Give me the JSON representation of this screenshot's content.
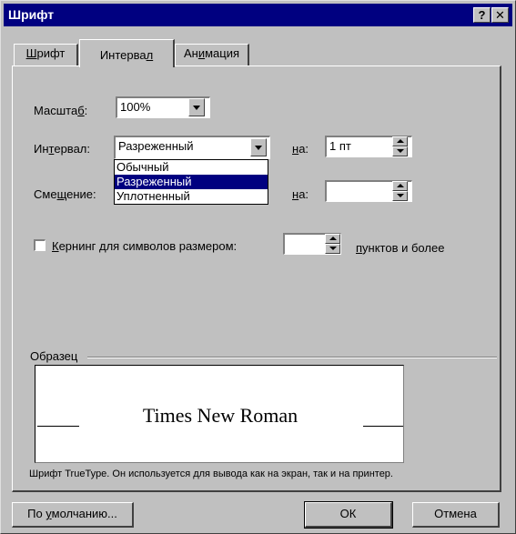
{
  "window": {
    "title": "Шрифт",
    "help_btn": "?",
    "close_btn": "✕"
  },
  "tabs": [
    {
      "label": "Шрифт",
      "underline": "Ш",
      "rest": "рифт"
    },
    {
      "label": "Интервал",
      "before": "Интерва",
      "underline": "л",
      "after": ""
    },
    {
      "label": "Анимация",
      "before": "Ан",
      "underline": "и",
      "after": "мация"
    }
  ],
  "form": {
    "scale_label_before": "Масшта",
    "scale_label_ul": "б",
    "scale_label_after": ":",
    "scale_value": "100%",
    "interval_label_before": "Ин",
    "interval_label_ul": "т",
    "interval_label_after": "ервал:",
    "interval_value": "Разреженный",
    "interval_options": [
      "Обычный",
      "Разреженный",
      "Уплотненный"
    ],
    "interval_selected_index": 1,
    "interval_by_label_ul": "н",
    "interval_by_label_after": "а:",
    "interval_by_value": "1 пт",
    "offset_label_before": "Сме",
    "offset_label_ul": "щ",
    "offset_label_after": "ение:",
    "offset_by_label_ul": "н",
    "offset_by_label_after": "а:",
    "offset_by_value": "",
    "kerning_checked": false,
    "kerning_label_ul": "К",
    "kerning_label_after": "ернинг для символов размером:",
    "kerning_value": "",
    "kerning_suffix_ul": "п",
    "kerning_suffix_after": "унктов и более"
  },
  "preview": {
    "group_label": "Образец",
    "sample_text": "Times New Roman",
    "note": "Шрифт TrueType. Он используется для вывода как на экран, так и на принтер."
  },
  "buttons": {
    "default_before": "По ",
    "default_ul": "у",
    "default_after": "молчанию...",
    "ok": "ОК",
    "cancel": "Отмена"
  }
}
